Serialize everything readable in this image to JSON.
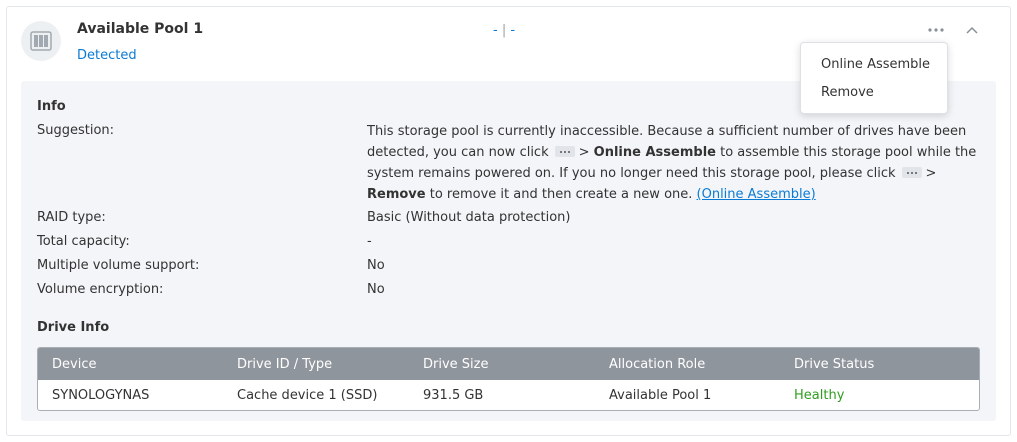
{
  "pool": {
    "title": "Available Pool 1",
    "status": "Detected",
    "usage_left": "-",
    "usage_sep": "|",
    "usage_right": "-"
  },
  "menu": {
    "items": [
      "Online Assemble",
      "Remove"
    ]
  },
  "info": {
    "title": "Info",
    "rows": [
      {
        "label": "Suggestion:",
        "value": ""
      },
      {
        "label": "RAID type:",
        "value": "Basic (Without data protection)"
      },
      {
        "label": "Total capacity:",
        "value": "-"
      },
      {
        "label": "Multiple volume support:",
        "value": "No"
      },
      {
        "label": "Volume encryption:",
        "value": "No"
      }
    ],
    "suggestion": {
      "p1": "This storage pool is currently inaccessible. Because a sufficient number of drives have been detected, you can now click",
      "p2": ">",
      "bold1": "Online Assemble",
      "p3": "to assemble this storage pool while the system remains powered on. If you no longer need this storage pool, please click",
      "p4": ">",
      "bold2": "Remove",
      "p5": "to remove it and then create a new one.",
      "link": "(Online Assemble)"
    }
  },
  "drive_info": {
    "title": "Drive Info",
    "columns": [
      "Device",
      "Drive ID / Type",
      "Drive Size",
      "Allocation Role",
      "Drive Status"
    ],
    "rows": [
      {
        "device": "SYNOLOGYNAS",
        "drive_id": "Cache device 1 (SSD)",
        "size": "931.5 GB",
        "role": "Available Pool 1",
        "status": "Healthy"
      }
    ]
  },
  "colors": {
    "accent": "#0a7bd4",
    "healthy": "#2f9e1f",
    "table_header": "#8f959c",
    "panel_bg": "#f3f5f8"
  },
  "icons": {
    "pool": "storage-pool-icon",
    "more": "more-horizontal-icon",
    "collapse": "chevron-up-icon",
    "inline_more": "more-horizontal-icon"
  }
}
